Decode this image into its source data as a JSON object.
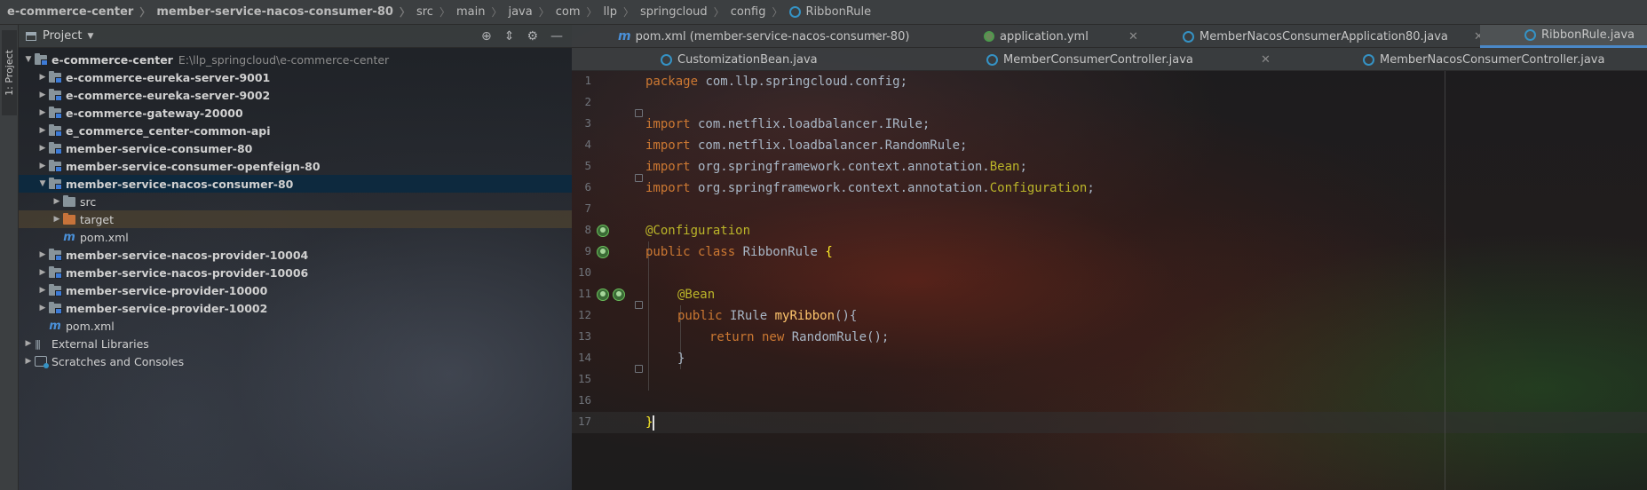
{
  "breadcrumb": {
    "items": [
      "e-commerce-center",
      "member-service-nacos-consumer-80",
      "src",
      "main",
      "java",
      "com",
      "llp",
      "springcloud",
      "config",
      "RibbonRule"
    ],
    "file_icon": "class-icon"
  },
  "tool_strip": {
    "project_tab_label": "1: Project"
  },
  "project_panel": {
    "title": "Project",
    "tool_icons": [
      "locate-icon",
      "collapse-icon",
      "gear-icon",
      "minimize-icon"
    ],
    "tree": [
      {
        "label": "e-commerce-center",
        "path": "E:\\llp_springcloud\\e-commerce-center",
        "level": 0,
        "expanded": true,
        "bold": true,
        "icon": "module-folder-icon"
      },
      {
        "label": "e-commerce-eureka-server-9001",
        "level": 1,
        "expanded": false,
        "bold": true,
        "icon": "module-folder-icon"
      },
      {
        "label": "e-commerce-eureka-server-9002",
        "level": 1,
        "expanded": false,
        "bold": true,
        "icon": "module-folder-icon"
      },
      {
        "label": "e-commerce-gateway-20000",
        "level": 1,
        "expanded": false,
        "bold": true,
        "icon": "module-folder-icon"
      },
      {
        "label": "e_commerce_center-common-api",
        "level": 1,
        "expanded": false,
        "bold": true,
        "icon": "module-folder-icon"
      },
      {
        "label": "member-service-consumer-80",
        "level": 1,
        "expanded": false,
        "bold": true,
        "icon": "module-folder-icon"
      },
      {
        "label": "member-service-consumer-openfeign-80",
        "level": 1,
        "expanded": false,
        "bold": true,
        "icon": "module-folder-icon"
      },
      {
        "label": "member-service-nacos-consumer-80",
        "level": 1,
        "expanded": true,
        "bold": true,
        "icon": "module-folder-icon",
        "selected": true
      },
      {
        "label": "src",
        "level": 2,
        "expanded": false,
        "bold": false,
        "icon": "folder-icon"
      },
      {
        "label": "target",
        "level": 2,
        "expanded": false,
        "bold": false,
        "icon": "excluded-folder-icon",
        "highlighted": true
      },
      {
        "label": "pom.xml",
        "level": 2,
        "leaf": true,
        "bold": false,
        "icon": "maven-icon"
      },
      {
        "label": "member-service-nacos-provider-10004",
        "level": 1,
        "expanded": false,
        "bold": true,
        "icon": "module-folder-icon"
      },
      {
        "label": "member-service-nacos-provider-10006",
        "level": 1,
        "expanded": false,
        "bold": true,
        "icon": "module-folder-icon"
      },
      {
        "label": "member-service-provider-10000",
        "level": 1,
        "expanded": false,
        "bold": true,
        "icon": "module-folder-icon"
      },
      {
        "label": "member-service-provider-10002",
        "level": 1,
        "expanded": false,
        "bold": true,
        "icon": "module-folder-icon"
      },
      {
        "label": "pom.xml",
        "level": 1,
        "leaf": true,
        "bold": false,
        "icon": "maven-icon"
      },
      {
        "label": "External Libraries",
        "level": 0,
        "expanded": false,
        "bold": false,
        "icon": "library-icon"
      },
      {
        "label": "Scratches and Consoles",
        "level": 0,
        "expanded": false,
        "bold": false,
        "icon": "scratch-icon"
      }
    ]
  },
  "editor": {
    "tabs_row1": [
      {
        "label": "pom.xml (member-service-nacos-consumer-80)",
        "icon": "maven-icon",
        "closable": true
      },
      {
        "label": "application.yml",
        "icon": "yml-icon",
        "closable": true
      },
      {
        "label": "MemberNacosConsumerApplication80.java",
        "icon": "class-icon",
        "closable": true
      },
      {
        "label": "RibbonRule.java",
        "icon": "class-icon",
        "closable": false,
        "active": true
      }
    ],
    "tabs_row2": [
      {
        "label": "CustomizationBean.java",
        "icon": "class-icon",
        "closable": false
      },
      {
        "label": "MemberConsumerController.java",
        "icon": "class-icon",
        "closable": true
      },
      {
        "label": "MemberNacosConsumerController.java",
        "icon": "class-icon",
        "closable": false
      }
    ],
    "line_numbers": [
      "1",
      "2",
      "3",
      "4",
      "5",
      "6",
      "7",
      "8",
      "9",
      "10",
      "11",
      "12",
      "13",
      "14",
      "15",
      "16",
      "17"
    ],
    "code": {
      "l1_kw": "package",
      "l1_rest": " com.llp.springcloud.config;",
      "l3_kw": "import",
      "l3_rest": " com.netflix.loadbalancer.IRule;",
      "l4_kw": "import",
      "l4_rest": " com.netflix.loadbalancer.RandomRule;",
      "l5_kw": "import",
      "l5_pkg": " org.springframework.context.annotation.",
      "l5_cls": "Bean",
      "l5_end": ";",
      "l6_kw": "import",
      "l6_pkg": " org.springframework.context.annotation.",
      "l6_cls": "Configuration",
      "l6_end": ";",
      "l8_ann": "@Configuration",
      "l9_kw": "public class",
      "l9_name": " RibbonRule ",
      "l9_brace": "{",
      "l11_ann": "@Bean",
      "l12_kw": "public",
      "l12_type": " IRule ",
      "l12_fn": "myRibbon",
      "l12_rest": "(){",
      "l13_kw": "return new",
      "l13_rest": " RandomRule();",
      "l14_brace": "}",
      "l16_brace": "}"
    }
  }
}
